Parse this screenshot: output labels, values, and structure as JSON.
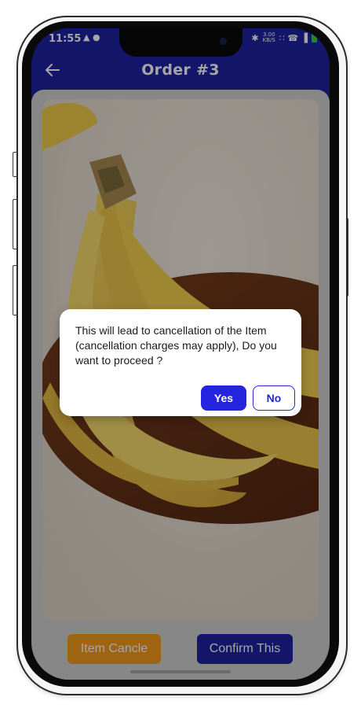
{
  "status_bar": {
    "time": "11:55",
    "left_icons": "▲ ●",
    "net_speed_top": "3.00",
    "net_speed_bottom": "KB/S",
    "right_icons": "∷ ☎ ▐"
  },
  "header": {
    "title": "Order #3",
    "back_icon": "arrow-left-icon"
  },
  "product": {
    "image_icon": "banana-photo"
  },
  "actions": {
    "cancel_label": "Item Cancle",
    "confirm_label": "Confirm This"
  },
  "dialog": {
    "message": "This will lead to cancellation of the Item (cancellation charges may apply), Do you want to proceed ?",
    "yes_label": "Yes",
    "no_label": "No"
  },
  "colors": {
    "app_bar": "#1f23a3",
    "cancel_button": "#f19a1c",
    "confirm_button": "#1f23a3",
    "dialog_primary": "#2525e0"
  }
}
